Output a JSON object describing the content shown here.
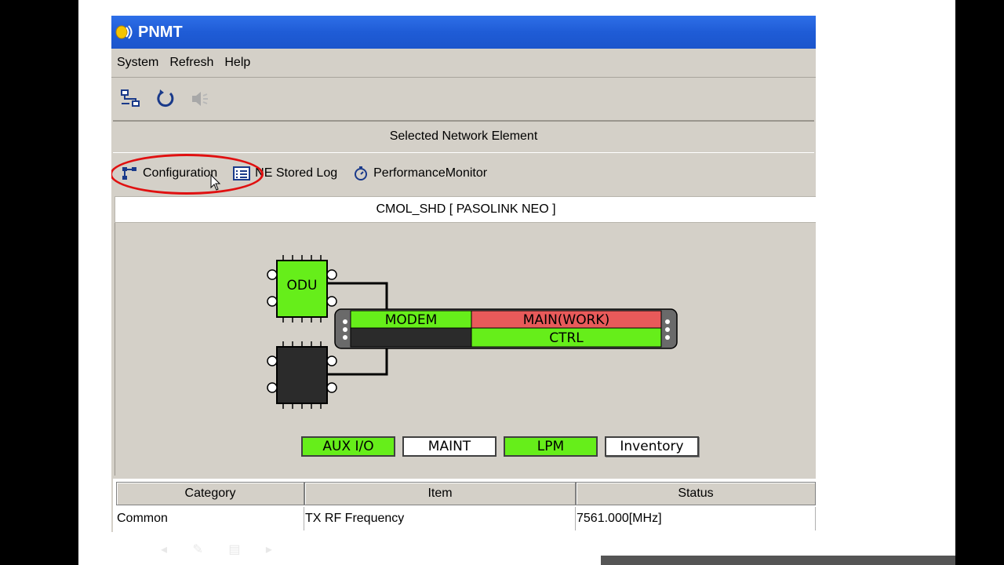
{
  "window": {
    "title": "PNMT",
    "menu": [
      "System",
      "Refresh",
      "Help"
    ],
    "toolbar_icons": [
      "network-icon",
      "refresh-icon",
      "speaker-icon"
    ]
  },
  "selected_ne": {
    "header": "Selected Network Element",
    "tabs": [
      {
        "label": "Configuration",
        "icon": "configuration-icon"
      },
      {
        "label": "NE Stored Log",
        "icon": "log-icon"
      },
      {
        "label": "PerformanceMonitor",
        "icon": "stopwatch-icon"
      }
    ],
    "name": "CMOL_SHD [ PASOLINK NEO ]"
  },
  "diagram": {
    "odu_label": "ODU",
    "modem_label": "MODEM",
    "main_label": "MAIN(WORK)",
    "ctrl_label": "CTRL",
    "colors": {
      "ok": "#66ee1a",
      "alarm": "#e85a5a",
      "inactive": "#2b2b2b"
    },
    "modules": [
      {
        "label": "AUX I/O",
        "state": "green"
      },
      {
        "label": "MAINT",
        "state": "white"
      },
      {
        "label": "LPM",
        "state": "green"
      },
      {
        "label": "Inventory",
        "state": "white"
      }
    ]
  },
  "table": {
    "headers": [
      "Category",
      "Item",
      "Status"
    ],
    "rows": [
      [
        "Common",
        "TX RF Frequency",
        "7561.000[MHz]"
      ]
    ]
  }
}
